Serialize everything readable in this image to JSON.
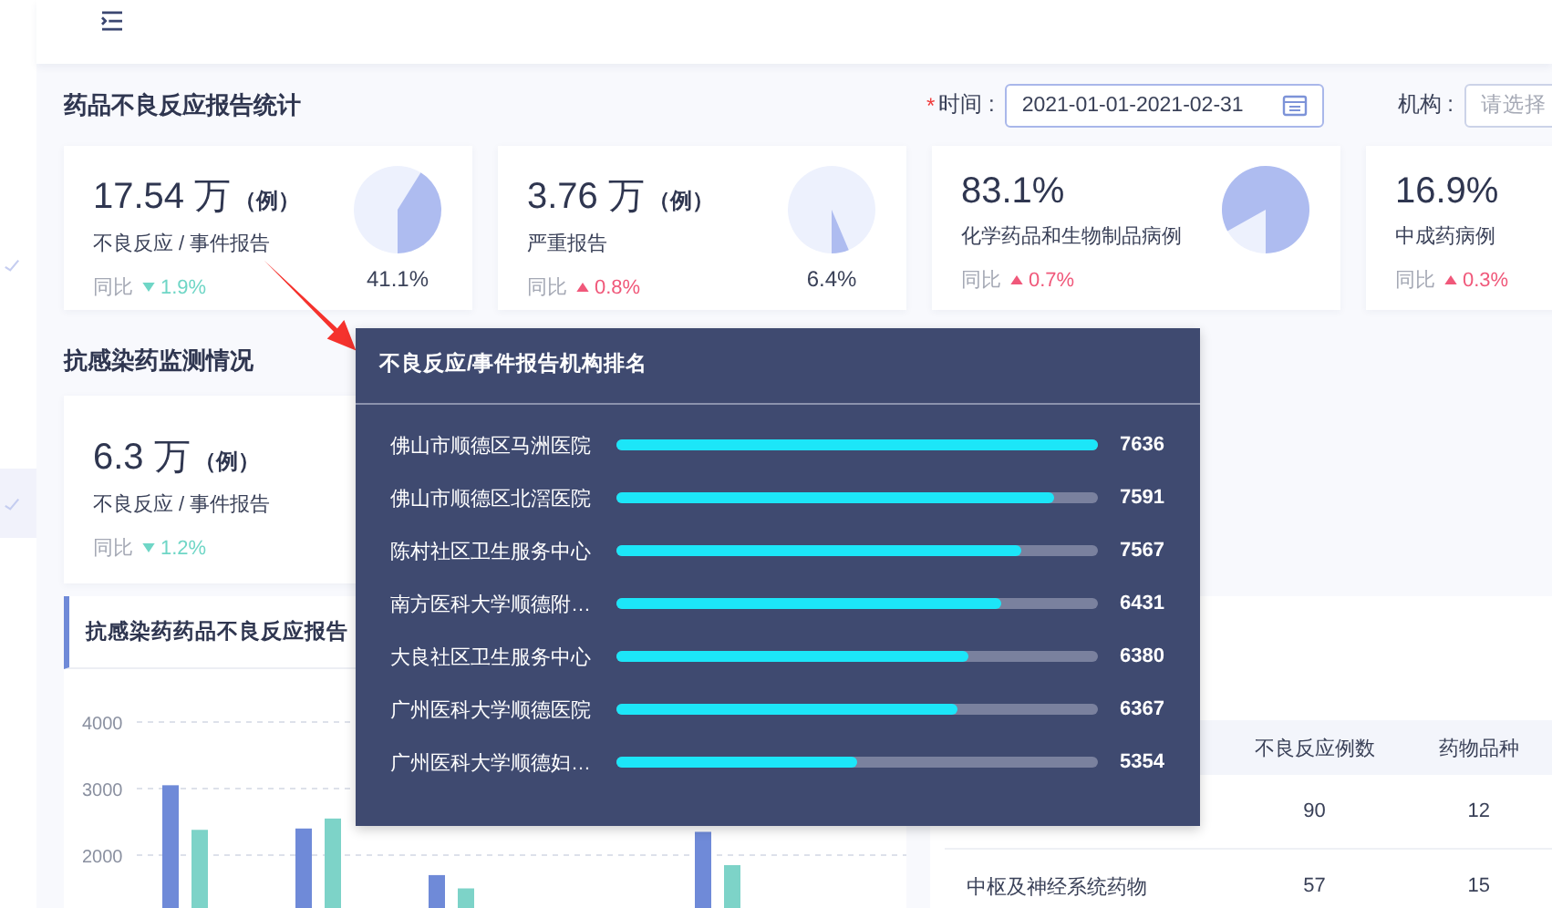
{
  "stats_section": {
    "title": "药品不良反应报告统计",
    "filters": [
      {
        "kind": "date",
        "required_mark": "*",
        "label": "时间 :",
        "value": "2021-01-01-2021-02-31"
      },
      {
        "kind": "select",
        "label": "机构 :",
        "placeholder": "请选择"
      }
    ],
    "cards": [
      {
        "value": "17.54 万",
        "unit": "（例）",
        "label": "不良反应 / 事件报告",
        "compare_label": "同比",
        "increase": false,
        "change": "1.9%",
        "pie": {
          "caption": "41.1%"
        }
      },
      {
        "value": "3.76 万",
        "unit": "（例）",
        "label": "严重报告",
        "compare_label": "同比",
        "increase": true,
        "change": "0.8%",
        "pie": {
          "caption": "6.4%"
        }
      },
      {
        "value": "83.1%",
        "label": "化学药品和生物制品病例",
        "compare_label": "同比",
        "increase": true,
        "change": "0.7%",
        "pie": {
          "shows_value": true
        }
      },
      {
        "value": "16.9%",
        "label": "中成药病例",
        "compare_label": "同比",
        "increase": true,
        "change": "0.3%"
      }
    ]
  },
  "monitor_section": {
    "title": "抗感染药监测情况",
    "cards": [
      {
        "value": "6.3 万",
        "unit": "（例）",
        "label": "不良反应 / 事件报告",
        "compare_label": "同比",
        "increase": false,
        "change": "1.2%"
      }
    ]
  },
  "age_panel": {
    "title": "抗感染药药品不良反应报告",
    "chart_data": {
      "type": "bar",
      "stacked": false,
      "grid": true,
      "ylim": [
        0,
        4000
      ],
      "yticks": [
        2000,
        3000,
        4000
      ],
      "series": [
        {
          "color": "#6f8ad8",
          "values": [
            3050,
            2400,
            1700,
            null,
            2350,
            null
          ]
        },
        {
          "color": "#7dd3c8",
          "values": [
            2380,
            2550,
            1500,
            null,
            1850,
            null
          ]
        }
      ]
    }
  },
  "adr_table": {
    "columns": [
      "不良反应例数",
      "药物品种"
    ],
    "rows": [
      {
        "cells": [
          "90",
          "12"
        ]
      },
      {
        "category": "中枢及神经系统药物",
        "cells": [
          "57",
          "15"
        ]
      }
    ]
  },
  "tooltip": {
    "title": "不良反应/事件报告机构排名",
    "rows": [
      {
        "name": "佛山市顺德区马洲医院",
        "level": 1.0,
        "value": "7636"
      },
      {
        "name": "佛山市顺德区北滘医院",
        "level": 0.91,
        "value": "7591"
      },
      {
        "name": "陈村社区卫生服务中心",
        "level": 0.84,
        "value": "7567"
      },
      {
        "name": "南方医科大学顺德附…",
        "level": 0.8,
        "value": "6431"
      },
      {
        "name": "大良社区卫生服务中心",
        "level": 0.73,
        "value": "6380"
      },
      {
        "name": "广州医科大学顺德医院",
        "level": 0.71,
        "value": "6367"
      },
      {
        "name": "广州医科大学顺德妇…",
        "level": 0.5,
        "value": "5354"
      }
    ]
  }
}
